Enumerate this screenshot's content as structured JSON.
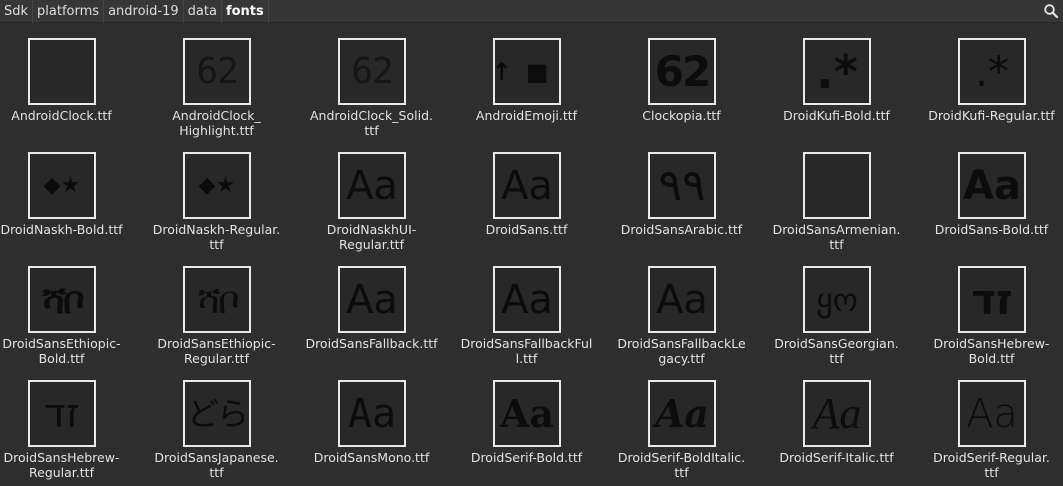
{
  "pathbar": {
    "crumbs": [
      "Sdk",
      "platforms",
      "android-19",
      "data",
      "fonts"
    ],
    "search_icon": "search-icon"
  },
  "colors": {
    "background": "#2e2e2e",
    "pathbar": "#363636",
    "thumb_border": "#e9e9e9",
    "thumb_fill": "#282828",
    "glyph": "#0c0c0c"
  },
  "files": [
    {
      "name": "AndroidClock.ttf",
      "label": "AndroidClock.ttf",
      "preview": "",
      "style": "g-sans"
    },
    {
      "name": "AndroidClock_Highlight.ttf",
      "label": "AndroidClock_\nHighlight.ttf",
      "preview": "62",
      "style": "g-thin"
    },
    {
      "name": "AndroidClock_Solid.ttf",
      "label": "AndroidClock_Solid.\nttf",
      "preview": "62",
      "style": "g-thin"
    },
    {
      "name": "AndroidEmoji.ttf",
      "label": "AndroidEmoji.ttf",
      "preview": "↑■",
      "style": "g-emoji"
    },
    {
      "name": "Clockopia.ttf",
      "label": "Clockopia.ttf",
      "preview": "62",
      "style": "g-clock"
    },
    {
      "name": "DroidKufi-Bold.ttf",
      "label": "DroidKufi-Bold.ttf",
      "preview": ".*",
      "style": "g-kufi"
    },
    {
      "name": "DroidKufi-Regular.ttf",
      "label": "DroidKufi-Regular.ttf",
      "preview": ".*",
      "style": "g-kufi-r"
    },
    {
      "name": "DroidNaskh-Bold.ttf",
      "label": "DroidNaskh-Bold.ttf",
      "preview": "◆★",
      "style": "g-naskh"
    },
    {
      "name": "DroidNaskh-Regular.ttf",
      "label": "DroidNaskh-Regular.\nttf",
      "preview": "◆★",
      "style": "g-naskh-r"
    },
    {
      "name": "DroidNaskhUI-Regular.ttf",
      "label": "DroidNaskhUI-\nRegular.ttf",
      "preview": "Aa",
      "style": "g-sans"
    },
    {
      "name": "DroidSans.ttf",
      "label": "DroidSans.ttf",
      "preview": "Aa",
      "style": "g-sans"
    },
    {
      "name": "DroidSansArabic.ttf",
      "label": "DroidSansArabic.ttf",
      "preview": "٩٩",
      "style": "g-arabic"
    },
    {
      "name": "DroidSansArmenian.ttf",
      "label": "DroidSansArmenian.\nttf",
      "preview": "",
      "style": "g-sans"
    },
    {
      "name": "DroidSans-Bold.ttf",
      "label": "DroidSans-Bold.ttf",
      "preview": "Aa",
      "style": "g-sans-bold"
    },
    {
      "name": "DroidSansEthiopic-Bold.ttf",
      "label": "DroidSansEthiopic-\nBold.ttf",
      "preview": "ሻቦ",
      "style": "g-eth"
    },
    {
      "name": "DroidSansEthiopic-Regular.ttf",
      "label": "DroidSansEthiopic-\nRegular.ttf",
      "preview": "ሻቦ",
      "style": "g-eth-r"
    },
    {
      "name": "DroidSansFallback.ttf",
      "label": "DroidSansFallback.ttf",
      "preview": "Aa",
      "style": "g-sans"
    },
    {
      "name": "DroidSansFallbackFull.ttf",
      "label": "DroidSansFallbackFul\nl.ttf",
      "preview": "Aa",
      "style": "g-sans"
    },
    {
      "name": "DroidSansFallbackLegacy.ttf",
      "label": "DroidSansFallbackLe\ngacy.ttf",
      "preview": "Aa",
      "style": "g-sans"
    },
    {
      "name": "DroidSansGeorgian.ttf",
      "label": "DroidSansGeorgian.\nttf",
      "preview": "ყო",
      "style": "g-geo"
    },
    {
      "name": "DroidSansHebrew-Bold.ttf",
      "label": "DroidSansHebrew-\nBold.ttf",
      "preview": "זד",
      "style": "g-heb"
    },
    {
      "name": "DroidSansHebrew-Regular.ttf",
      "label": "DroidSansHebrew-\nRegular.ttf",
      "preview": "זד",
      "style": "g-heb-r"
    },
    {
      "name": "DroidSansJapanese.ttf",
      "label": "DroidSansJapanese.\nttf",
      "preview": "どら",
      "style": "g-jp"
    },
    {
      "name": "DroidSansMono.ttf",
      "label": "DroidSansMono.ttf",
      "preview": "Aa",
      "style": "g-mono"
    },
    {
      "name": "DroidSerif-Bold.ttf",
      "label": "DroidSerif-Bold.ttf",
      "preview": "Aa",
      "style": "g-serif-bold"
    },
    {
      "name": "DroidSerif-BoldItalic.ttf",
      "label": "DroidSerif-BoldItalic.\nttf",
      "preview": "Aa",
      "style": "g-serif-bi"
    },
    {
      "name": "DroidSerif-Italic.ttf",
      "label": "DroidSerif-Italic.ttf",
      "preview": "Aa",
      "style": "g-serif-i"
    },
    {
      "name": "DroidSerif-Regular.ttf",
      "label": "DroidSerif-Regular.\nttf",
      "preview": "Aa",
      "style": "g-serif"
    }
  ]
}
